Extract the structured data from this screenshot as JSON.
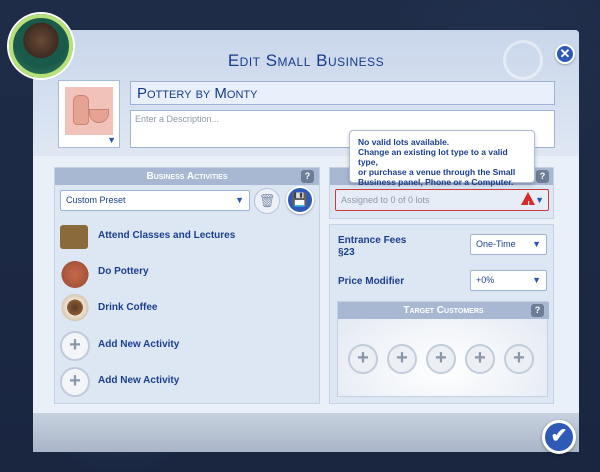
{
  "dialog": {
    "title": "Edit Small Business",
    "close_icon": "close-icon",
    "confirm_icon": "checkmark-icon"
  },
  "business": {
    "name": "Pottery by Monty",
    "description_placeholder": "Enter a Description..."
  },
  "tooltip": {
    "lines": [
      "No valid lots available.",
      "Change an existing lot type to a valid type,",
      "or purchase a venue through the Small",
      "Business panel, Phone or a Computer."
    ]
  },
  "activities_panel": {
    "header": "Business Activities",
    "help": "?",
    "preset": "Custom Preset",
    "items": [
      {
        "label": "Attend Classes and Lectures",
        "icon": "chalkboard-icon"
      },
      {
        "label": "Do Pottery",
        "icon": "pottery-vase-icon"
      },
      {
        "label": "Drink Coffee",
        "icon": "coffee-cup-icon"
      },
      {
        "label": "Add New Activity",
        "icon": "plus-icon"
      },
      {
        "label": "Add New Activity",
        "icon": "plus-icon"
      }
    ]
  },
  "lots_panel": {
    "help": "?",
    "assigned": "Assigned to 0 of 0 lots",
    "warning_icon": "warning-icon"
  },
  "fees": {
    "entrance_label": "Entrance Fees",
    "entrance_value": "§23",
    "entrance_mode": "One-Time",
    "price_modifier_label": "Price Modifier",
    "price_modifier_value": "+0%"
  },
  "target_customers": {
    "header": "Target Customers",
    "help": "?",
    "slots": [
      "+",
      "+",
      "+",
      "+",
      "+"
    ]
  },
  "colors": {
    "accent": "#2f59b7",
    "title": "#173b8a",
    "warning": "#d32a2a"
  }
}
